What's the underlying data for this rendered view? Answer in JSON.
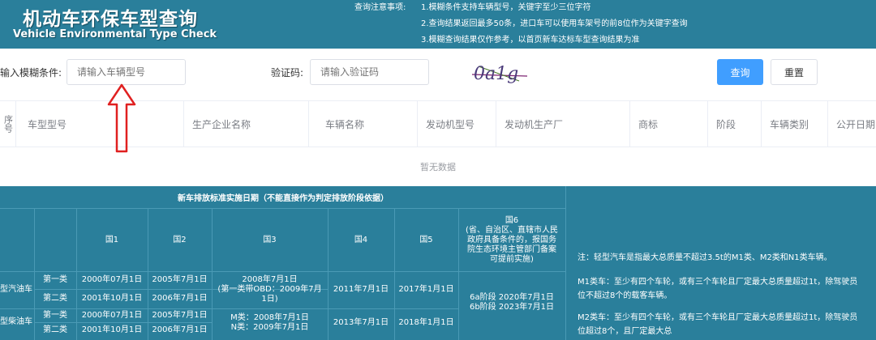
{
  "header": {
    "title_cn": "机动车环保车型查询",
    "title_en": "Vehicle Environmental Type Check",
    "notice_title": "查询注意事项:",
    "notices": [
      "1.模糊条件支持车辆型号，关键字至少三位字符",
      "2.查询结果返回最多50条，进口车可以使用车架号的前8位作为关键字查询",
      "3.模糊查询结果仅作参考，以首页新车达标车型查询结果为准"
    ]
  },
  "search": {
    "label": "输入模糊条件:",
    "placeholder": "请输入车辆型号",
    "captcha_label": "验证码:",
    "captcha_placeholder": "请输入验证码",
    "captcha_text": "0a1g",
    "query_button": "查询",
    "reset_button": "重置"
  },
  "results": {
    "columns": [
      "序号",
      "车型型号",
      "生产企业名称",
      "车辆名称",
      "发动机型号",
      "发动机生产厂",
      "商标",
      "阶段",
      "车辆类别",
      "公开日期"
    ],
    "empty_text": "暂无数据"
  },
  "standards": {
    "title": "新车排放标准实施日期（不能直接作为判定排放阶段依据）",
    "headers": [
      "国1",
      "国2",
      "国3",
      "国4",
      "国5"
    ],
    "guo6_header": [
      "国6",
      "(省、自治区、直辖市人民",
      "政府具备条件的，报国务",
      "院生态环境主管部门备案",
      "可提前实施)"
    ],
    "rows": {
      "gasoline_label": "型汽油车",
      "diesel_label": "型柴油车",
      "class1": "第一类",
      "class2": "第二类",
      "gas_c1": [
        "2000年07月1日",
        "2005年7月1日"
      ],
      "gas_c2": [
        "2001年10月1日",
        "2006年7月1日"
      ],
      "gas_guo3": [
        "2008年7月1日",
        "(第一类带OBD：2009年7月",
        "1日)"
      ],
      "gas_guo4": "2011年7月1日",
      "gas_guo5": "2017年1月1日",
      "guo6": [
        "6a阶段 2020年7月1日",
        "6b阶段 2023年7月1日"
      ],
      "die_c1": [
        "2000年07月1日",
        "2005年7月1日"
      ],
      "die_c2": [
        "2001年10月1日",
        "2006年7月1日"
      ],
      "die_guo3": [
        "M类：2008年7月1日",
        "N类：2009年7月1日"
      ],
      "die_guo4": "2013年7月1日",
      "die_guo5": "2018年1月1日"
    }
  },
  "notes": [
    "注：轻型汽车是指最大总质量不超过3.5t的M1类、M2类和N1类车辆。",
    "M1类车：至少有四个车轮，或有三个车轮且厂定最大总质量超过1t，除驾驶员",
    "位不超过8个的载客车辆。",
    "M2类车：至少有四个车轮，或有三个车轮且厂定最大总质量超过1t，除驾驶员",
    "位超过8个，且厂定最大总"
  ],
  "colors": {
    "header_bg": "#2a7f9b",
    "primary": "#409eff",
    "arrow": "#e02020"
  }
}
